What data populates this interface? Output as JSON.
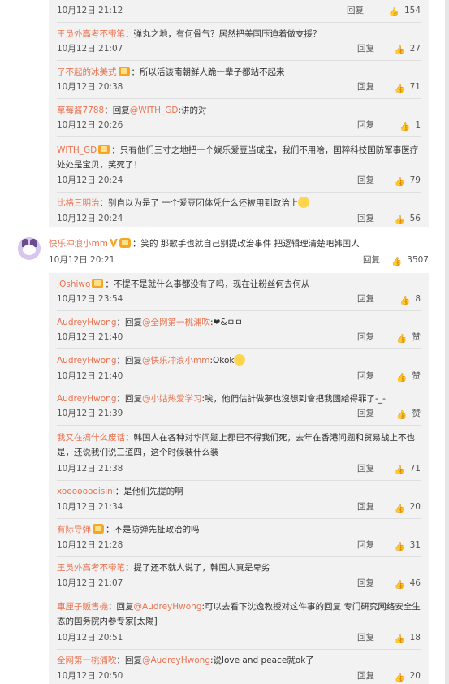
{
  "panel_a": {
    "items": [
      {
        "user": "",
        "sep": "",
        "mention": "",
        "text": "",
        "date": "10月12日 21:12",
        "reply": "回复",
        "likes": "154"
      },
      {
        "user": "王员外高考不带笔",
        "sep": "：",
        "mention": "",
        "text": "弹丸之地，有何骨气？居然把美国压迫着做支援？",
        "date": "10月12日 21:07",
        "reply": "回复",
        "likes": "27"
      },
      {
        "user": "了不起的冰美式",
        "sep": "：",
        "mention": "",
        "text": "所以活该南朝鲜人跪一辈子都站不起来",
        "date": "10月12日 20:38",
        "reply": "回复",
        "likes": "71"
      },
      {
        "user": "草莓酱7788",
        "sep": "：回复",
        "mention": "@WITH_GD",
        "text": ":讲的对",
        "date": "10月12日 20:26",
        "reply": "回复",
        "likes": "1"
      },
      {
        "user": "WITH_GD",
        "sep": "：",
        "mention": "",
        "text": "只有他们三寸之地把一个娱乐爱豆当成宝，我们不用啥，国粹科技国防军事医疗处处是宝贝，笑死了！",
        "date": "10月12日 20:24",
        "reply": "回复",
        "likes": "79"
      },
      {
        "user": "比格三明治",
        "sep": "：",
        "mention": "",
        "text": "别自以为是了 一个爱豆团体凭什么还被用到政治上",
        "date": "10月12日 20:24",
        "reply": "回复",
        "likes": "56"
      }
    ]
  },
  "main_comment": {
    "user": "快乐冲浪小mm",
    "sep": "：",
    "text": "笑的 那歌手也就自己别提政治事件 把逻辑理清楚吧韩国人",
    "date": "10月12日 20:21",
    "reply": "回复",
    "likes": "3507"
  },
  "panel_b": {
    "items": [
      {
        "user": "JOshiwo",
        "sep": "：",
        "mention": "",
        "text": "不提不是就什么事都没有了吗，现在让粉丝何去何从",
        "date": "10月12日 23:54",
        "reply": "回复",
        "likes": "8"
      },
      {
        "user": "AudreyHwong",
        "sep": "：回复",
        "mention": "@全网第一桃浦吹",
        "text": ":❤&ㅁㅁ",
        "date": "10月12日 21:40",
        "reply": "回复",
        "likes": "赞"
      },
      {
        "user": "AudreyHwong",
        "sep": "：回复",
        "mention": "@快乐冲浪小mm",
        "text": ":Okok",
        "date": "10月12日 21:40",
        "reply": "回复",
        "likes": "赞"
      },
      {
        "user": "AudreyHwong",
        "sep": "：回复",
        "mention": "@小姑热爱学习",
        "text": ":唉，他們估計做夢也沒想到會把我國給得罪了-_-",
        "date": "10月12日 21:39",
        "reply": "回复",
        "likes": "赞"
      },
      {
        "user": "我又在搞什么废话",
        "sep": "：",
        "mention": "",
        "text": "韩国人在各种对华问题上都巴不得我们死，去年在香港问题和贸易战上不也是，还说我们说三道四，这个时候装什么装",
        "date": "10月12日 21:38",
        "reply": "回复",
        "likes": "71"
      },
      {
        "user": "xoooooooisini",
        "sep": "：",
        "mention": "",
        "text": "是他们先提的啊",
        "date": "10月12日 21:34",
        "reply": "回复",
        "likes": "20"
      },
      {
        "user": "有际导弹",
        "sep": "：",
        "mention": "",
        "text": "不是防弹先扯政治的吗",
        "date": "10月12日 21:28",
        "reply": "回复",
        "likes": "31"
      },
      {
        "user": "王员外高考不带笔",
        "sep": "：",
        "mention": "",
        "text": "提了还不就人说了，韩国人真是卑劣",
        "date": "10月12日 21:07",
        "reply": "回复",
        "likes": "46"
      },
      {
        "user": "車厘子販售機",
        "sep": "：回复",
        "mention": "@AudreyHwong",
        "text": ":可以去看下沈逸教授对这件事的回复 专门研究网络安全生态的国务院内参专家[太陽]",
        "date": "10月12日 20:51",
        "reply": "回复",
        "likes": "18"
      },
      {
        "user": "全网第一桃浦吹",
        "sep": "：回复",
        "mention": "@AudreyHwong",
        "text": ":说love and peace就ok了",
        "date": "10月12日 20:50",
        "reply": "回复",
        "likes": "20"
      }
    ]
  }
}
